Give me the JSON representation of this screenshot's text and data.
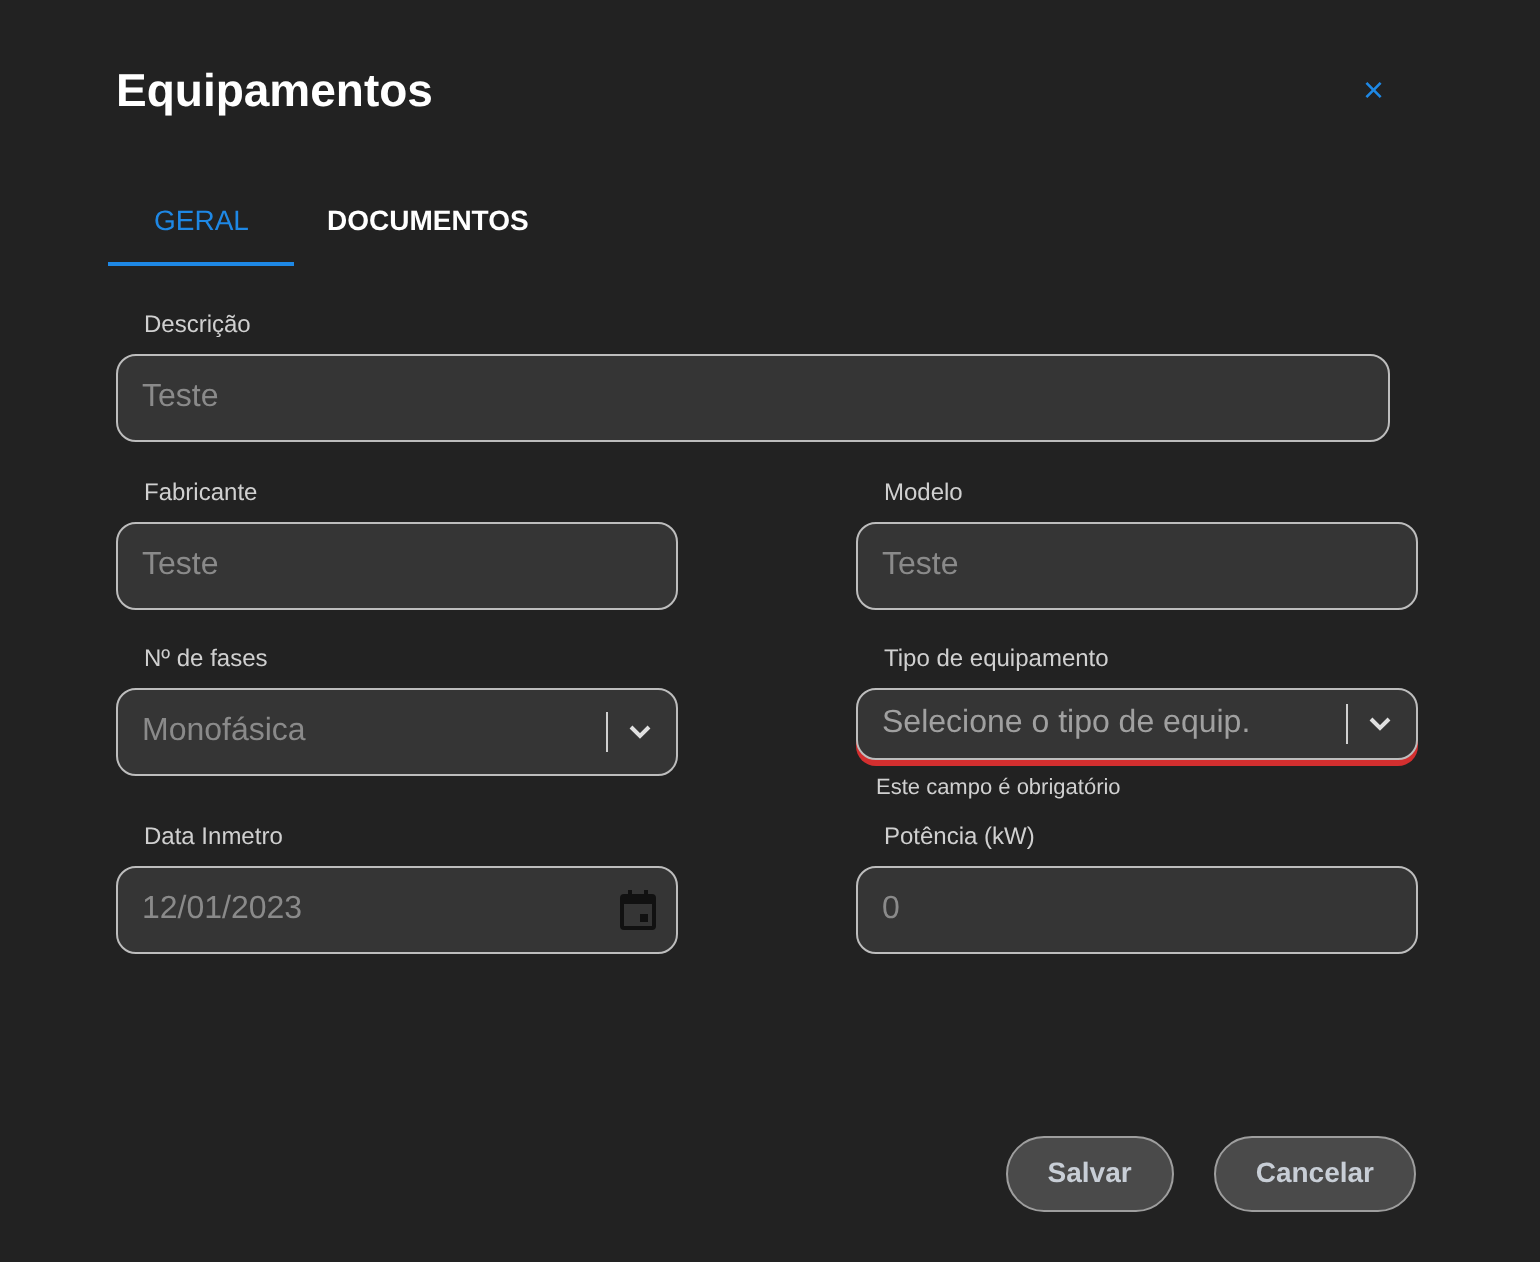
{
  "dialog": {
    "title": "Equipamentos",
    "close": "×"
  },
  "tabs": [
    {
      "label": "GERAL",
      "selected": true
    },
    {
      "label": "DOCUMENTOS",
      "selected": false
    }
  ],
  "description": {
    "label": "Descrição",
    "kind": "text",
    "value": "Teste"
  },
  "fields": [
    {
      "label": "Fabricante",
      "kind": "text",
      "value": "Teste"
    },
    {
      "label": "Modelo",
      "kind": "text",
      "value": "Teste"
    },
    {
      "label": "Nº de fases",
      "kind": "select",
      "value": "Monofásica"
    },
    {
      "label": "Tipo de equipamento",
      "kind": "select",
      "placeholder": "Selecione o tipo de equip.",
      "error": "Este campo é obrigatório"
    },
    {
      "label": "Data Inmetro",
      "kind": "date",
      "value": "12/01/2023"
    },
    {
      "label": "Potência (kW)",
      "kind": "text",
      "value": "0"
    }
  ],
  "buttons": [
    "Salvar",
    "Cancelar"
  ]
}
